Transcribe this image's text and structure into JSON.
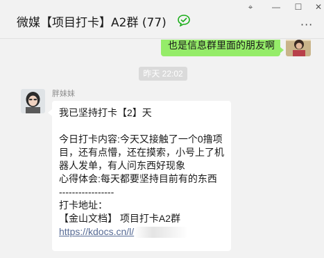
{
  "window": {
    "title": "微媒【项目打卡】A2群 (77)",
    "controls": {
      "pin_glyph": "⌖",
      "minimize_glyph": "—",
      "maximize_glyph": "☐",
      "close_glyph": "✕"
    },
    "more_glyph": "···"
  },
  "colors": {
    "out_bubble": "#95ec69",
    "in_bubble": "#ffffff",
    "link": "#576b95",
    "badge": "#1aad19"
  },
  "messages": {
    "outgoing": {
      "text": "也是信息群里面的朋友啊"
    },
    "timestamp": "昨天 22:02",
    "incoming": {
      "sender": "胖妹妹",
      "lines": [
        "我已坚持打卡【2】天",
        "",
        "今日打卡内容:今天又接触了一个0撸项",
        "目，还有点懵，还在摸索，小号上了机",
        "器人发单，有人问东西好现象",
        "心得体会:每天都要坚持目前有的东西",
        "-----------------",
        "打卡地址：",
        "【金山文档】 项目打卡A2群"
      ],
      "link_text": "https://kdocs.cn/l/"
    }
  }
}
